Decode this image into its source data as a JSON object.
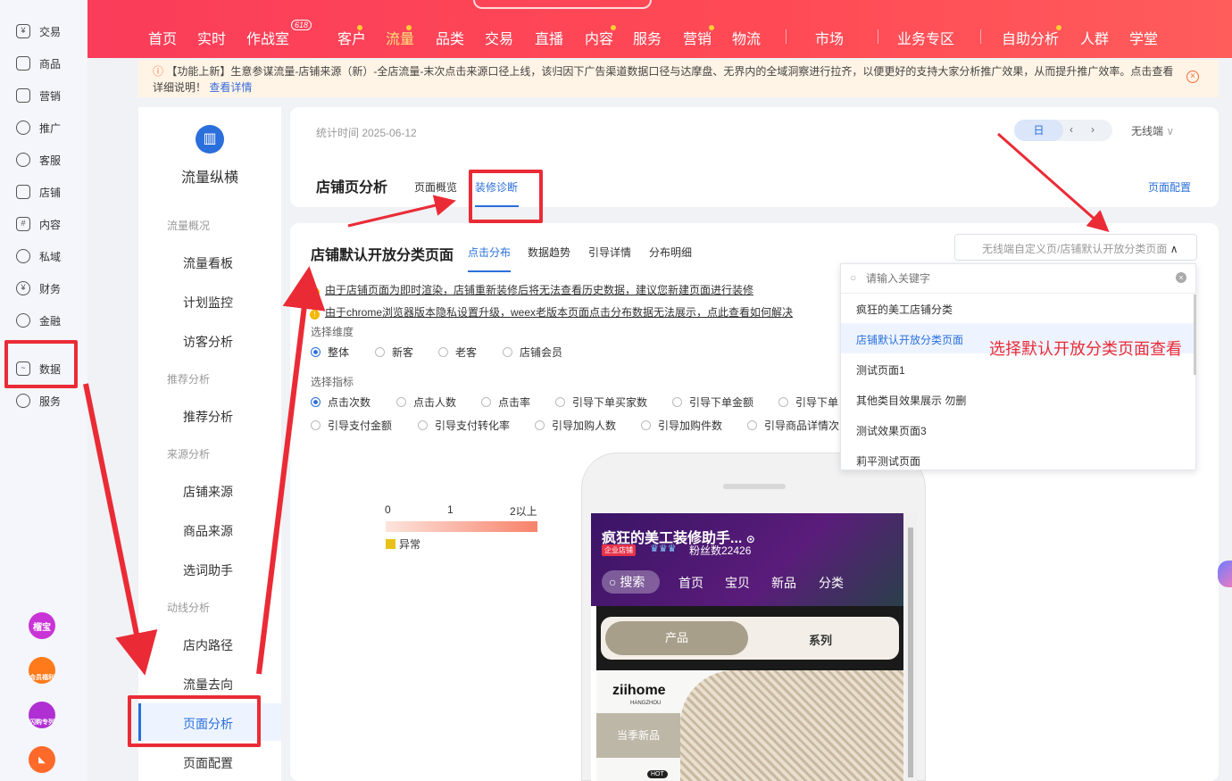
{
  "sidebar": {
    "items": [
      {
        "label": "交易",
        "icon": "trade-icon"
      },
      {
        "label": "商品",
        "icon": "goods-icon"
      },
      {
        "label": "营销",
        "icon": "marketing-icon"
      },
      {
        "label": "推广",
        "icon": "promotion-icon"
      },
      {
        "label": "客服",
        "icon": "service-icon"
      },
      {
        "label": "店铺",
        "icon": "shop-icon"
      },
      {
        "label": "内容",
        "icon": "content-icon"
      },
      {
        "label": "私域",
        "icon": "private-icon"
      },
      {
        "label": "财务",
        "icon": "finance-icon"
      },
      {
        "label": "金融",
        "icon": "loan-icon"
      },
      {
        "label": "数据",
        "icon": "data-icon"
      },
      {
        "label": "服务",
        "icon": "apps-icon"
      }
    ],
    "apps": [
      {
        "label": "榴宝"
      },
      {
        "label": "会员福利"
      },
      {
        "label": "闪购专列"
      },
      {
        "label": ""
      }
    ]
  },
  "topnav": {
    "items": [
      "首页",
      "实时",
      "作战室",
      "客户",
      "流量",
      "品类",
      "交易",
      "直播",
      "内容",
      "服务",
      "营销",
      "物流",
      "市场",
      "业务专区",
      "自助分析",
      "人群",
      "学堂"
    ],
    "badge": "618"
  },
  "notice": {
    "text": "【功能上新】生意参谋流量-店铺来源（新）-全店流量-末次点击来源口径上线，该归因下广告渠道数据口径与达摩盘、无界内的全域洞察进行拉齐，以便更好的支持大家分析推广效果，从而提升推广效率。点击查看详细说明！",
    "link": "查看详情"
  },
  "leftpanel": {
    "title": "流量纵横",
    "groups": [
      "流量概况",
      "推荐分析",
      "来源分析",
      "动线分析"
    ],
    "items": [
      "流量看板",
      "计划监控",
      "访客分析",
      "推荐分析",
      "店铺来源",
      "商品来源",
      "选词助手",
      "店内路径",
      "流量去向",
      "页面分析",
      "页面配置"
    ]
  },
  "header": {
    "stat_time": "统计时间 2025-06-12",
    "day_btn": "日",
    "device": "无线端",
    "title": "店铺页分析",
    "tabs": [
      "页面概览",
      "装修诊断"
    ],
    "config_link": "页面配置"
  },
  "main": {
    "title": "店铺默认开放分类页面",
    "tabs": [
      "点击分布",
      "数据趋势",
      "引导详情",
      "分布明细"
    ],
    "select_value": "无线端自定义页/店铺默认开放分类页面",
    "tips": [
      "由于店铺页面为即时渲染，店铺重新装修后将无法查看历史数据，建议您新建页面进行装修",
      "由于chrome浏览器版本隐私设置升级，weex老版本页面点击分布数据无法展示，点此查看如何解决",
      "点此查看"
    ],
    "dim_label": "选择维度",
    "dims": [
      "整体",
      "新客",
      "老客",
      "店铺会员"
    ],
    "metric_label": "选择指标",
    "metrics_row1": [
      "点击次数",
      "点击人数",
      "点击率",
      "引导下单买家数",
      "引导下单金额",
      "引导下单"
    ],
    "metrics_row2": [
      "引导支付金额",
      "引导支付转化率",
      "引导加购人数",
      "引导加购件数",
      "引导商品详情次"
    ],
    "legend": {
      "min": "0",
      "mid": "1",
      "max": "2以上",
      "abnormal": "异常"
    }
  },
  "dropdown": {
    "placeholder": "请输入关键字",
    "items": [
      "疯狂的美工店铺分类",
      "店铺默认开放分类页面",
      "测试页面1",
      "其他类目效果展示 勿删",
      "测试效果页面3",
      "莉平测试页面"
    ]
  },
  "annotation": "选择默认开放分类页面查看",
  "phone": {
    "shop_name": "疯狂的美工装修助手...",
    "badge": "企业店铺",
    "fans": "粉丝数22426",
    "nav": [
      "搜索",
      "首页",
      "宝贝",
      "新品",
      "分类"
    ],
    "seg": [
      "产品",
      "系列"
    ],
    "brand": "ziihome",
    "brand_sub": "HANGZHOU",
    "banner": "当季新品",
    "hot": "HOT"
  },
  "colors": {
    "accent": "#2a6fdb",
    "brand_red": "#ff4056",
    "highlight": "#ea2b36"
  }
}
